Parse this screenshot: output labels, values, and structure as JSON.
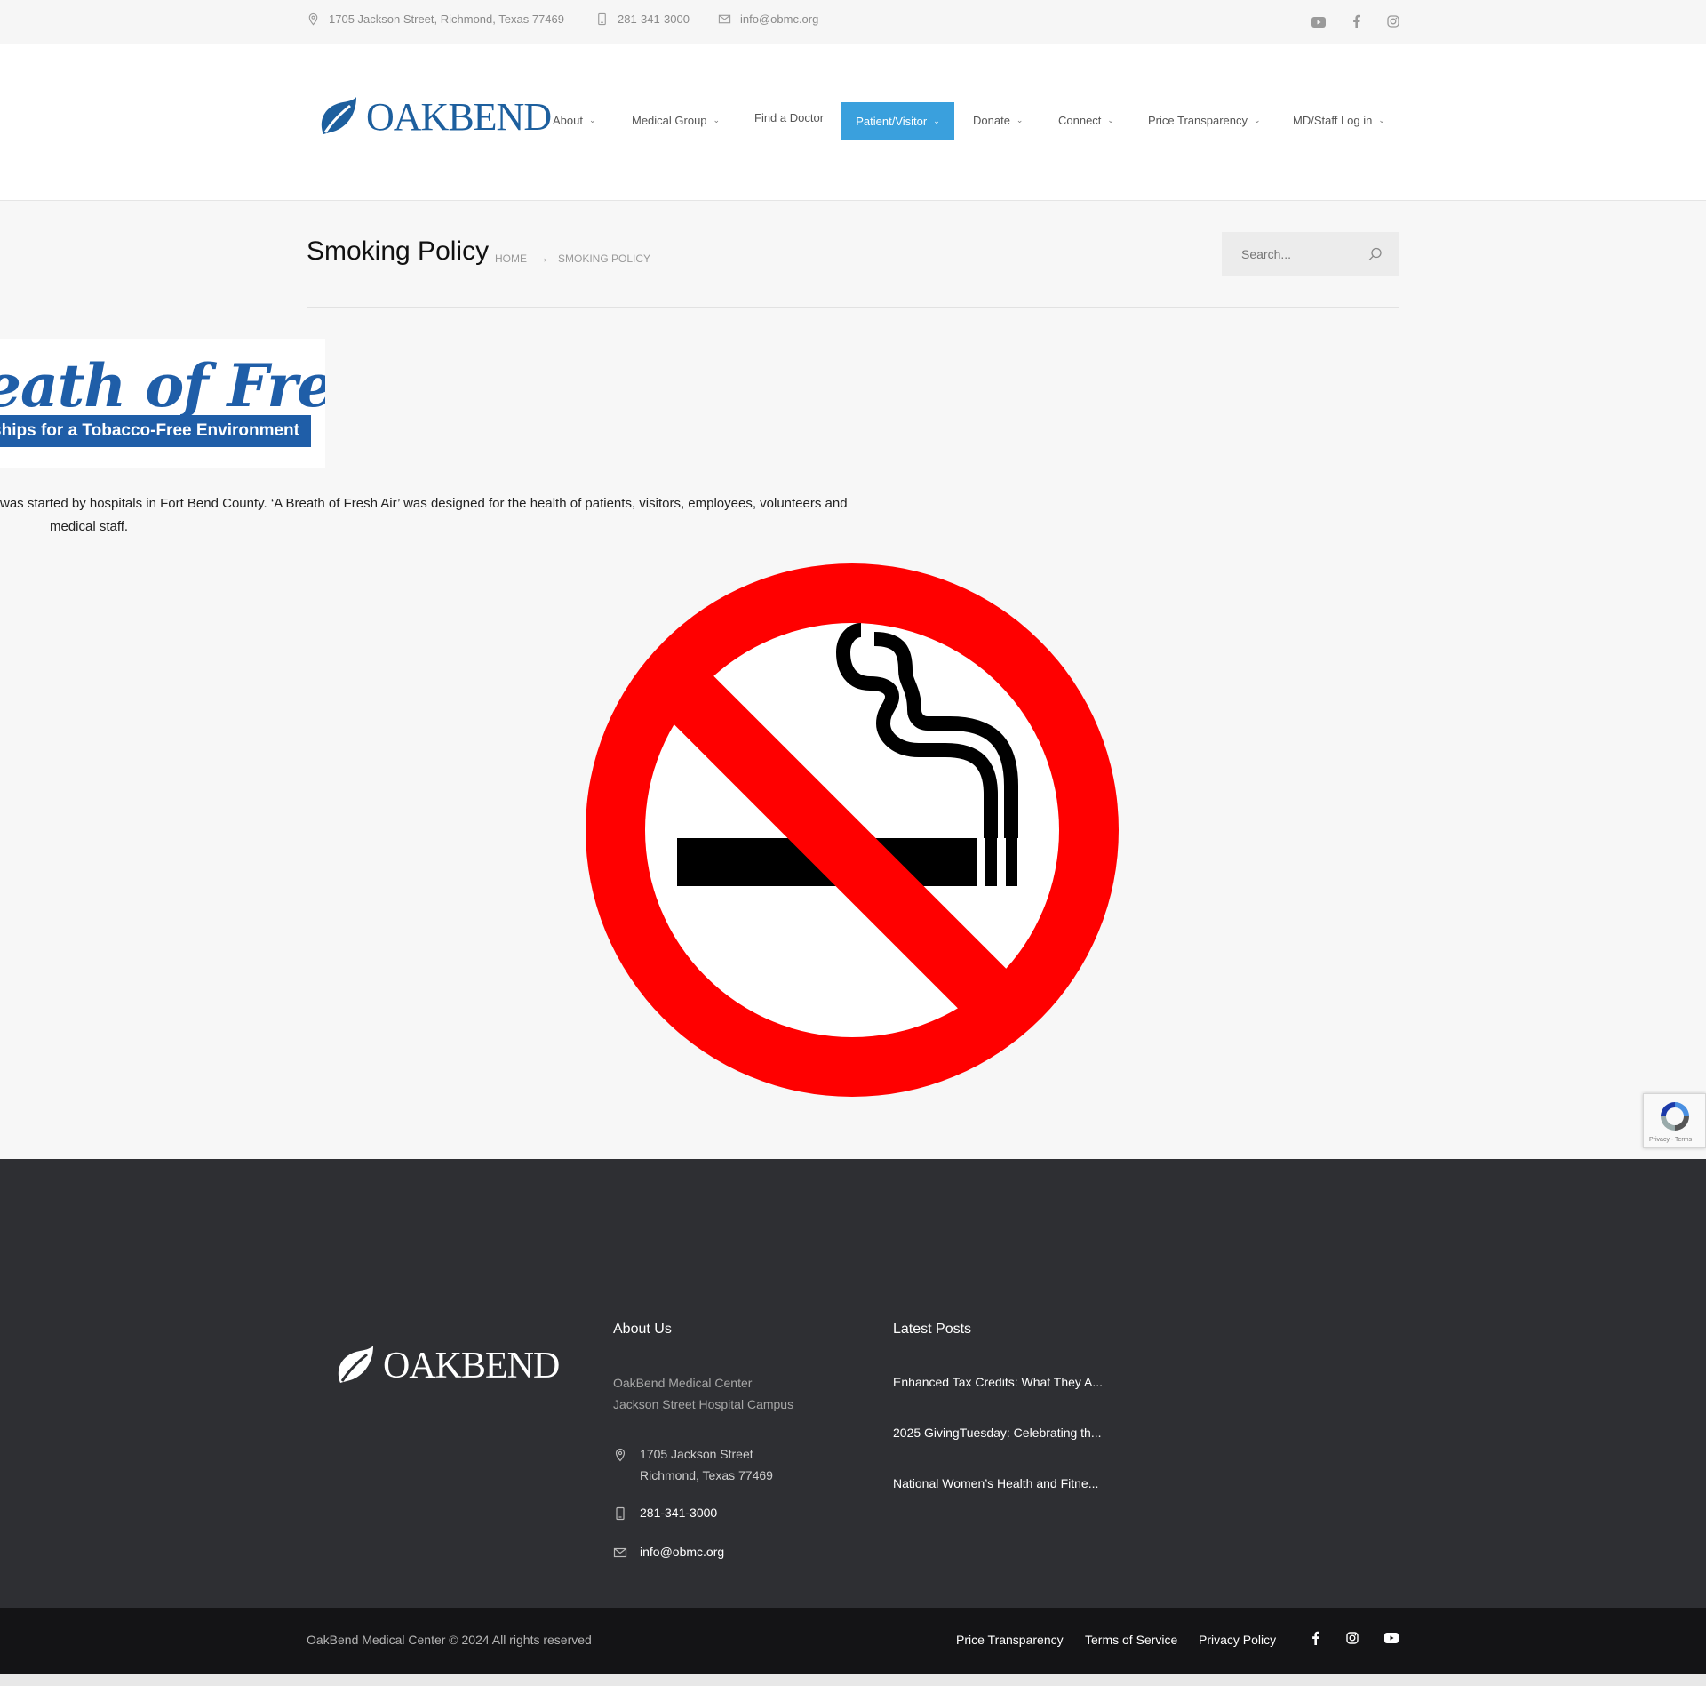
{
  "topbar": {
    "address": "1705 Jackson Street, Richmond, Texas 77469",
    "phone": "281-341-3000",
    "email": "info@obmc.org"
  },
  "header": {
    "logo_text": "OAKBEND",
    "nav": [
      "About",
      "Medical Group",
      "Find a Doctor",
      "Patient/Visitor",
      "Donate",
      "Connect",
      "Price Transparency",
      "MD/Staff Log in"
    ],
    "active_nav": "Patient/Visitor"
  },
  "page": {
    "title": "Smoking Policy",
    "breadcrumb_home": "HOME",
    "breadcrumb_current": "SMOKING POLICY",
    "search_placeholder": "Search...",
    "banner_script": "eath of Fresh Air",
    "banner_strip": "erships for a Tobacco-Free Environment",
    "body_line1": "was started by hospitals in Fort Bend County. ‘A Breath of Fresh Air’ was designed for the health of patients, visitors, employees, volunteers and",
    "body_line2": "medical staff.",
    "recaptcha_label": "Privacy - Terms"
  },
  "footer": {
    "logo_text": "OAKBEND",
    "about_heading": "About Us",
    "about_line1": "OakBend Medical Center",
    "about_line2": "Jackson Street Hospital Campus",
    "address_line1": "1705 Jackson Street",
    "address_line2": "Richmond, Texas 77469",
    "phone": "281-341-3000",
    "email": "info@obmc.org",
    "posts_heading": "Latest Posts",
    "posts": [
      "Enhanced Tax Credits: What They A...",
      "2025 GivingTuesday: Celebrating th...",
      "National Women’s Health and Fitne..."
    ]
  },
  "bottombar": {
    "copyright": "OakBend Medical Center © 2024 All rights reserved",
    "links": [
      "Price Transparency",
      "Terms of Service",
      "Privacy Policy"
    ]
  },
  "colors": {
    "brand_blue": "#1d5f9e",
    "nav_active": "#3aa0dd",
    "sign_red": "#ff0000",
    "footer_bg": "#2e2f33"
  }
}
